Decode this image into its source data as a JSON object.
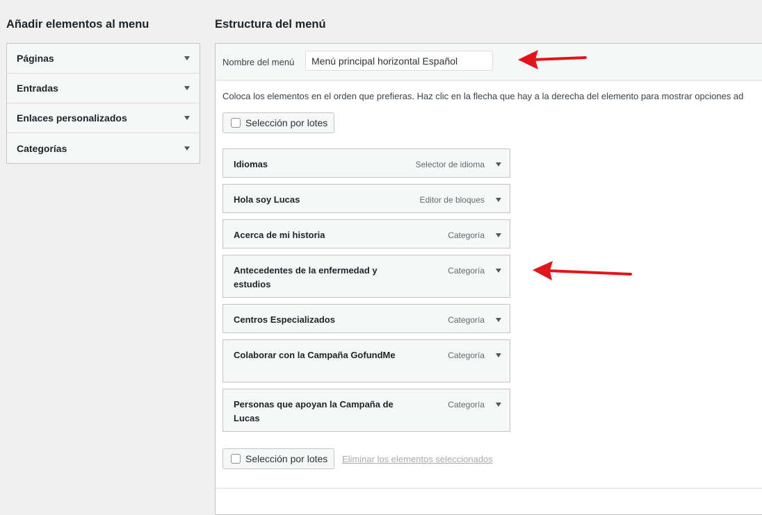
{
  "left": {
    "heading": "Añadir elementos al menu",
    "sections": [
      {
        "label": "Páginas"
      },
      {
        "label": "Entradas"
      },
      {
        "label": "Enlaces personalizados"
      },
      {
        "label": "Categorías"
      }
    ]
  },
  "right": {
    "heading": "Estructura del menú",
    "name_label": "Nombre del menú",
    "name_value": "Menú principal horizontal Español",
    "instructions": "Coloca los elementos en el orden que prefieras. Haz clic en la flecha que hay a la derecha del elemento para mostrar opciones ad",
    "bulk_select_label": "Selección por lotes",
    "delete_selected_label": "Eliminar los elementos seleccionados",
    "items": [
      {
        "title": "Idiomas",
        "type": "Selector de idioma"
      },
      {
        "title": "Hola soy Lucas",
        "type": "Editor de bloques"
      },
      {
        "title": "Acerca de mi historia",
        "type": "Categoría"
      },
      {
        "title": "Antecedentes de la enfermedad y estudios",
        "type": "Categoría"
      },
      {
        "title": "Centros Especializados",
        "type": "Categoría"
      },
      {
        "title": "Colaborar con la Campaña GofundMe",
        "type": "Categoría"
      },
      {
        "title": "Personas que apoyan la Campaña de Lucas",
        "type": "Categoría"
      }
    ]
  },
  "colors": {
    "annotation_arrow": "#e0161b",
    "background": "#f0f0f1"
  },
  "icons": {
    "section_toggle": "triangle-down-icon",
    "item_toggle": "triangle-down-icon",
    "annotation": "red-arrow-icon"
  }
}
